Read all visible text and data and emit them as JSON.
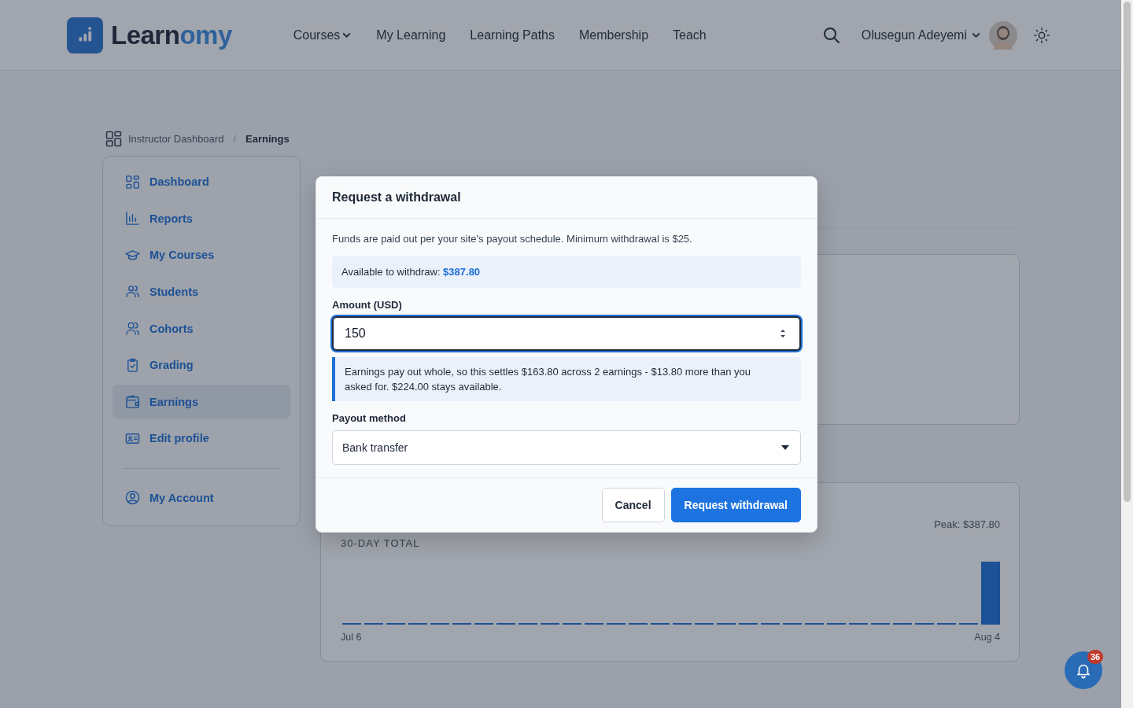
{
  "header": {
    "logo": {
      "text": "Learn",
      "accent": "omy"
    },
    "nav": [
      {
        "label": "Courses",
        "dropdown": true
      },
      {
        "label": "My Learning",
        "dropdown": false
      },
      {
        "label": "Learning Paths",
        "dropdown": false
      },
      {
        "label": "Membership",
        "dropdown": false
      },
      {
        "label": "Teach",
        "dropdown": false
      }
    ],
    "user": {
      "name": "Olusegun Adeyemi"
    }
  },
  "breadcrumb": {
    "items": [
      {
        "label": "Instructor Dashboard",
        "current": false
      },
      {
        "label": "Earnings",
        "current": true
      }
    ],
    "separator": "/"
  },
  "sidebar": {
    "items": [
      {
        "label": "Dashboard",
        "selected": false
      },
      {
        "label": "Reports",
        "selected": false
      },
      {
        "label": "My Courses",
        "selected": false
      },
      {
        "label": "Students",
        "selected": false
      },
      {
        "label": "Cohorts",
        "selected": false
      },
      {
        "label": "Grading",
        "selected": false
      },
      {
        "label": "Earnings",
        "selected": true
      },
      {
        "label": "Edit profile",
        "selected": false
      }
    ],
    "footer_items": [
      {
        "label": "My Account",
        "selected": false
      }
    ]
  },
  "chart_card": {
    "peak": "Peak: $387.80",
    "total_label": "30-DAY TOTAL",
    "start_label": "Jul 6",
    "end_label": "Aug 4"
  },
  "modal": {
    "title": "Request a withdrawal",
    "intro": "Funds are paid out per your site's payout schedule. Minimum withdrawal is $25.",
    "available": "Available to withdraw: **$387.80**",
    "amount_label": "Amount (USD)",
    "amount_value": "150",
    "note": "Earnings pay out whole, so this settles $163.80 across 2 earnings - $13.80 more than you asked for. $224.00 stays available.",
    "payout_label": "Payout method",
    "payout_value": "Bank transfer",
    "buttons": [
      {
        "label": "Cancel",
        "kind": "secondary"
      },
      {
        "label": "Request withdrawal",
        "kind": "primary"
      }
    ]
  },
  "notifications": {
    "count": "36"
  }
}
